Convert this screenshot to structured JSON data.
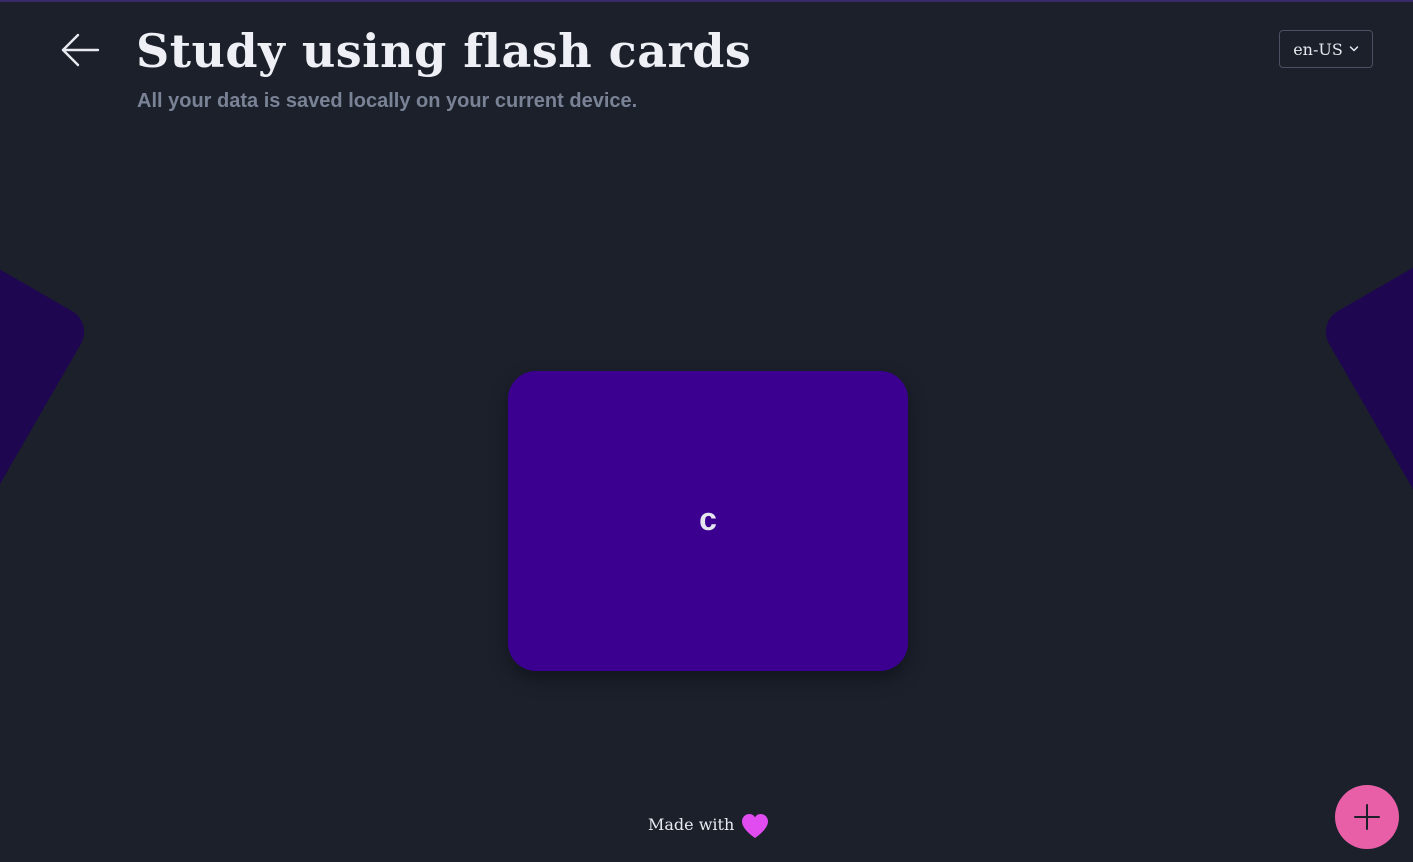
{
  "header": {
    "title": "Study using flash cards",
    "subtitle": "All your data is saved locally on your current device.",
    "back_icon": "arrow-left-icon"
  },
  "language_select": {
    "value": "en-US",
    "icon": "chevron-down-icon"
  },
  "cards": {
    "current_text": "c"
  },
  "footer": {
    "made_with": "Made with",
    "icon": "heart-icon"
  },
  "actions": {
    "add_icon": "plus-icon"
  },
  "colors": {
    "background": "#1b202b",
    "card": "#3c0090",
    "side_card": "#1f0650",
    "heart": "#e04cf0",
    "add_button": "#e85fa8"
  }
}
